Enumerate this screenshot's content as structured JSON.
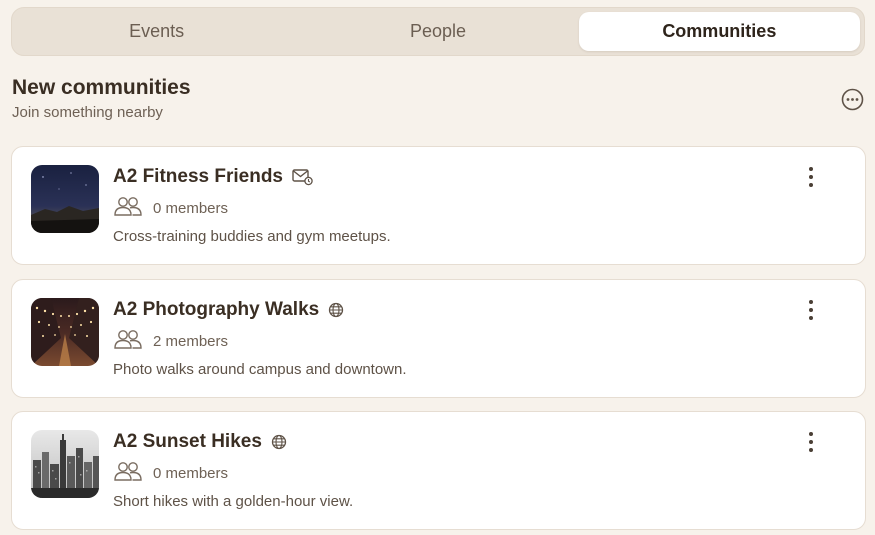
{
  "tabs": [
    {
      "label": "Events",
      "active": false
    },
    {
      "label": "People",
      "active": false
    },
    {
      "label": "Communities",
      "active": true
    }
  ],
  "section": {
    "title": "New communities",
    "subtitle": "Join something nearby",
    "more_icon": "ellipsis-circle-icon"
  },
  "communities": [
    {
      "name": "A2 Fitness Friends",
      "visibility_icon": "invite-mail-icon",
      "members": "0 members",
      "description": "Cross-training buddies and gym meetups.",
      "thumbnail": "night-sky-mountains"
    },
    {
      "name": "A2 Photography Walks",
      "visibility_icon": "globe-icon",
      "members": "2 members",
      "description": "Photo walks around campus and downtown.",
      "thumbnail": "string-lights-street"
    },
    {
      "name": "A2 Sunset Hikes",
      "visibility_icon": "globe-icon",
      "members": "0 members",
      "description": "Short hikes with a golden-hour view.",
      "thumbnail": "city-skyline-bw"
    }
  ],
  "colors": {
    "background": "#f7f2eb",
    "tab_track": "#e9e1d6",
    "card": "#ffffff",
    "text_primary": "#3a2e23",
    "text_secondary": "#6e6155"
  }
}
